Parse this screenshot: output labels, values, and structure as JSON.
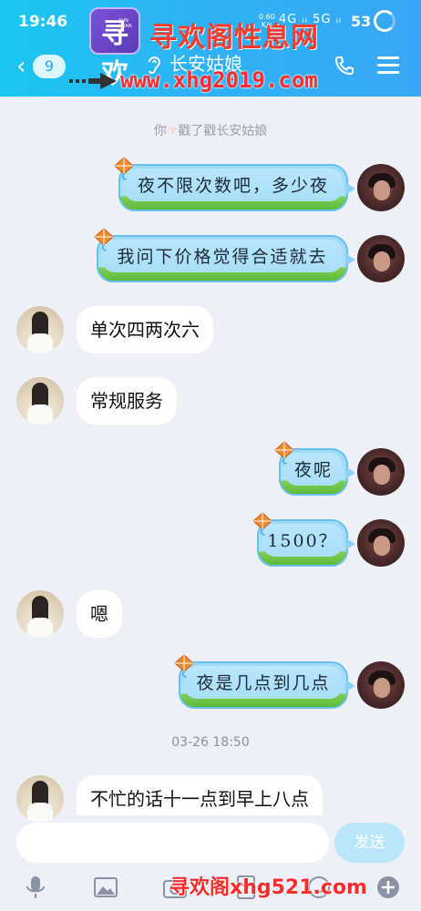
{
  "status_bar": {
    "time": "19:46",
    "net_speed": "0.60",
    "net_unit": "K/s",
    "signal_text": "4G ᵢₗ 5G ᵢₗ",
    "battery": "53"
  },
  "header": {
    "unread_count": "9",
    "title": "长安姑娘",
    "ear_icon": "ear-icon",
    "phone_icon": "phone-icon",
    "menu_icon": "menu-icon",
    "accent_color": "#2db3f5"
  },
  "watermark": {
    "logo_char": "寻欢",
    "logo_sub": "XUN HUAN",
    "site_name": "寻欢阁性息网",
    "url": "www.xhg2019.com",
    "bottom_text": "寻欢阁xhg521.com"
  },
  "chat": {
    "poke_prefix": "你",
    "poke_text": "戳了戳长安姑娘",
    "timestamp": "03-26 18:50",
    "messages": [
      {
        "side": "right",
        "text": "夜不限次数吧，多少夜"
      },
      {
        "side": "right",
        "text": "我问下价格觉得合适就去"
      },
      {
        "side": "left",
        "text": "单次四两次六"
      },
      {
        "side": "left",
        "text": "常规服务"
      },
      {
        "side": "right",
        "text": "夜呢"
      },
      {
        "side": "right",
        "text": "1500？"
      },
      {
        "side": "left",
        "text": "嗯"
      },
      {
        "side": "right",
        "text": "夜是几点到几点"
      },
      {
        "side": "left",
        "text": "不忙的话十一点到早上八点"
      }
    ]
  },
  "input": {
    "value": "",
    "placeholder": "",
    "send_label": "发送"
  },
  "toolbar": {
    "icons": [
      "microphone-icon",
      "image-icon",
      "camera-icon",
      "red-packet-icon",
      "emoji-icon",
      "plus-icon"
    ]
  }
}
